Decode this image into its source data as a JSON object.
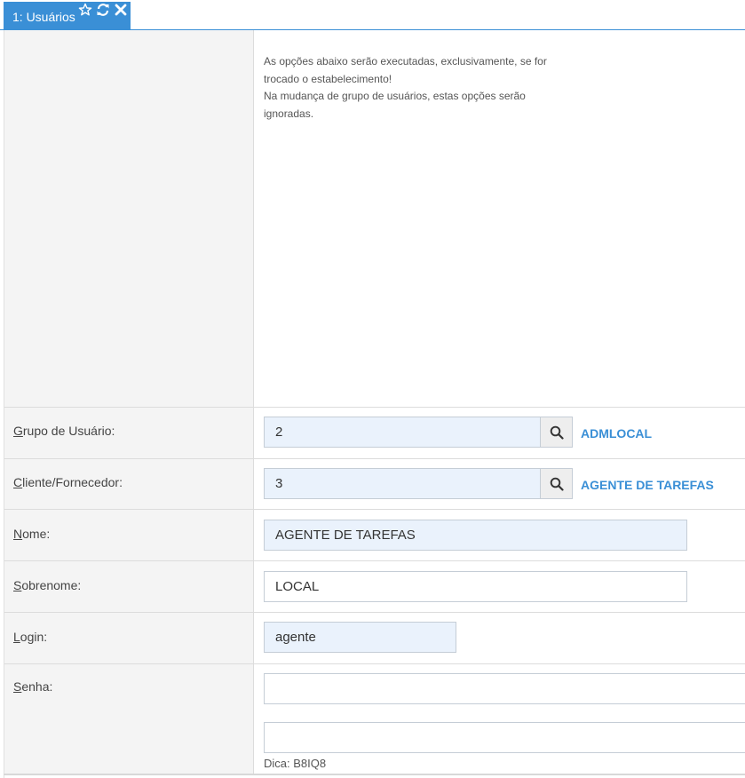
{
  "tab": {
    "label": "1: Usuários"
  },
  "info": {
    "lines": [
      "As opções abaixo serão executadas, exclusivamente, se for",
      "trocado o estabelecimento!",
      "Na mudança de grupo de usuários, estas opções serão",
      "ignoradas."
    ]
  },
  "fields": {
    "grupo": {
      "label_first": "G",
      "label_rest": "rupo de Usuário:",
      "value": "2",
      "lookup": "ADMLOCAL"
    },
    "cliente": {
      "label_first": "C",
      "label_rest": "liente/Fornecedor:",
      "value": "3",
      "lookup": "AGENTE DE TAREFAS"
    },
    "nome": {
      "label_first": "N",
      "label_rest": "ome:",
      "value": "AGENTE DE TAREFAS"
    },
    "sobrenome": {
      "label_first": "S",
      "label_rest": "obrenome:",
      "value": "LOCAL"
    },
    "login": {
      "label_first": "L",
      "label_rest": "ogin:",
      "value": "agente"
    },
    "senha": {
      "label_first": "S",
      "label_rest": "enha:",
      "value": "",
      "confirm_value": "",
      "hint": "Dica: B8IQ8"
    }
  },
  "colors": {
    "accent": "#3a8fd6",
    "tinted_input": "#eaf2fc",
    "label_bg": "#f4f4f4"
  },
  "icons": {
    "favorite": "star-icon",
    "reload": "refresh-icon",
    "close": "close-icon",
    "search": "search-icon"
  }
}
